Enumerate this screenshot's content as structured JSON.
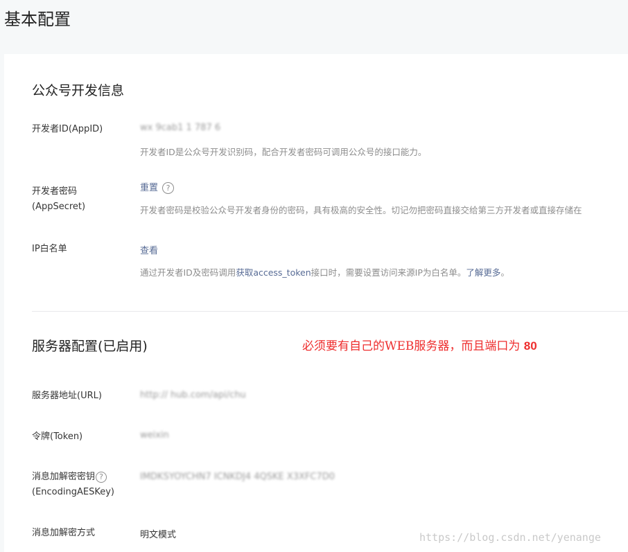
{
  "page": {
    "title": "基本配置"
  },
  "dev_info": {
    "section_title": "公众号开发信息",
    "appid": {
      "label": "开发者ID(AppID)",
      "value": "wx 9cab1 1 787 6",
      "desc": "开发者ID是公众号开发识别码，配合开发者密码可调用公众号的接口能力。"
    },
    "appsecret": {
      "label_line1": "开发者密码",
      "label_line2": "(AppSecret)",
      "action": "重置",
      "desc": "开发者密码是校验公众号开发者身份的密码，具有极高的安全性。切记勿把密码直接交给第三方开发者或直接存储在"
    },
    "ip_whitelist": {
      "label": "IP白名单",
      "action": "查看",
      "desc_prefix": "通过开发者ID及密码调用",
      "desc_link1": "获取access_token",
      "desc_middle": "接口时，需要设置访问来源IP为白名单。",
      "desc_link2": "了解更多"
    }
  },
  "server_config": {
    "section_title": "服务器配置(已启用)",
    "url": {
      "label": "服务器地址(URL)",
      "value": "http://  hub.com/api/chu"
    },
    "token": {
      "label": "令牌(Token)",
      "value": "weixin"
    },
    "aes_key": {
      "label_line1": "消息加解密密钥",
      "label_line2": "(EncodingAESKey)",
      "value": "  IMDKSYOYCHN7   ICNKDJ4 4QSKE X3XFC7D0"
    },
    "encrypt_mode": {
      "label": "消息加解密方式",
      "value": "明文模式"
    }
  },
  "annotation": {
    "text": "必须要有自己的WEB服务器，而且端口为 ",
    "number": "80"
  },
  "watermark": "https://blog.csdn.net/yenange",
  "colors": {
    "link": "#576b95",
    "annotation": "#ee2d2d",
    "muted": "#8d8d8d"
  },
  "icons": {
    "help": "help-circle-icon"
  }
}
